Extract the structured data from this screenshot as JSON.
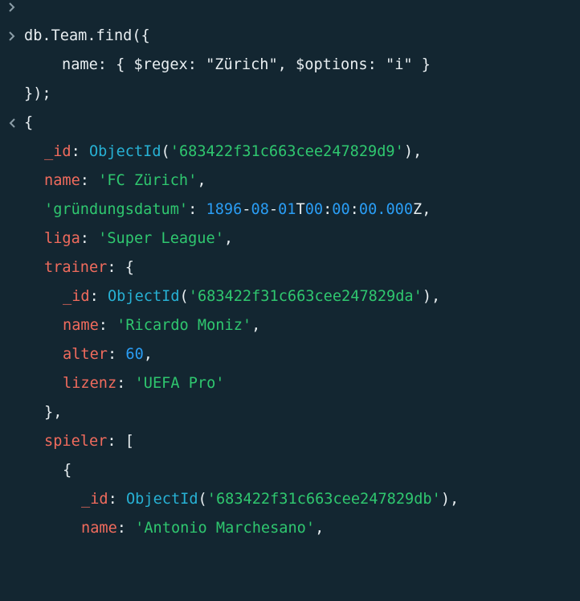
{
  "input": {
    "line1": "db.Team.find({",
    "line2": "name: { $regex: \"Zürich\", $options: \"i\" }",
    "line3": "});"
  },
  "prompts": {
    "input_icon": "chevron-right-icon",
    "output_icon": "chevron-left-icon"
  },
  "colors": {
    "background": "#132631",
    "key": "#f06b5d",
    "string": "#2fc76f",
    "number": "#2a9df4",
    "function": "#27b1d4",
    "plain": "#e8eef1"
  },
  "output": {
    "open_brace": "{",
    "id": {
      "key": "_id",
      "fn": "ObjectId",
      "value": "'683422f31c663cee247829d9'"
    },
    "name": {
      "key": "name",
      "value": "'FC Zürich'"
    },
    "gruendung": {
      "key": "'gründungsdatum'",
      "year": "1896",
      "month": "08",
      "day": "01",
      "t": "T",
      "hour": "00",
      "minute": "00",
      "second": "00.000",
      "z": "Z"
    },
    "liga": {
      "key": "liga",
      "value": "'Super League'"
    },
    "trainer": {
      "key": "trainer",
      "open": "{",
      "id": {
        "key": "_id",
        "fn": "ObjectId",
        "value": "'683422f31c663cee247829da'"
      },
      "name": {
        "key": "name",
        "value": "'Ricardo Moniz'"
      },
      "alter": {
        "key": "alter",
        "value": "60"
      },
      "lizenz": {
        "key": "lizenz",
        "value": "'UEFA Pro'"
      },
      "close": "},"
    },
    "spieler": {
      "key": "spieler",
      "open": "[",
      "item_open": "{",
      "item": {
        "id": {
          "key": "_id",
          "fn": "ObjectId",
          "value": "'683422f31c663cee247829db'"
        },
        "name": {
          "key": "name",
          "value": "'Antonio Marchesano'"
        }
      }
    }
  }
}
